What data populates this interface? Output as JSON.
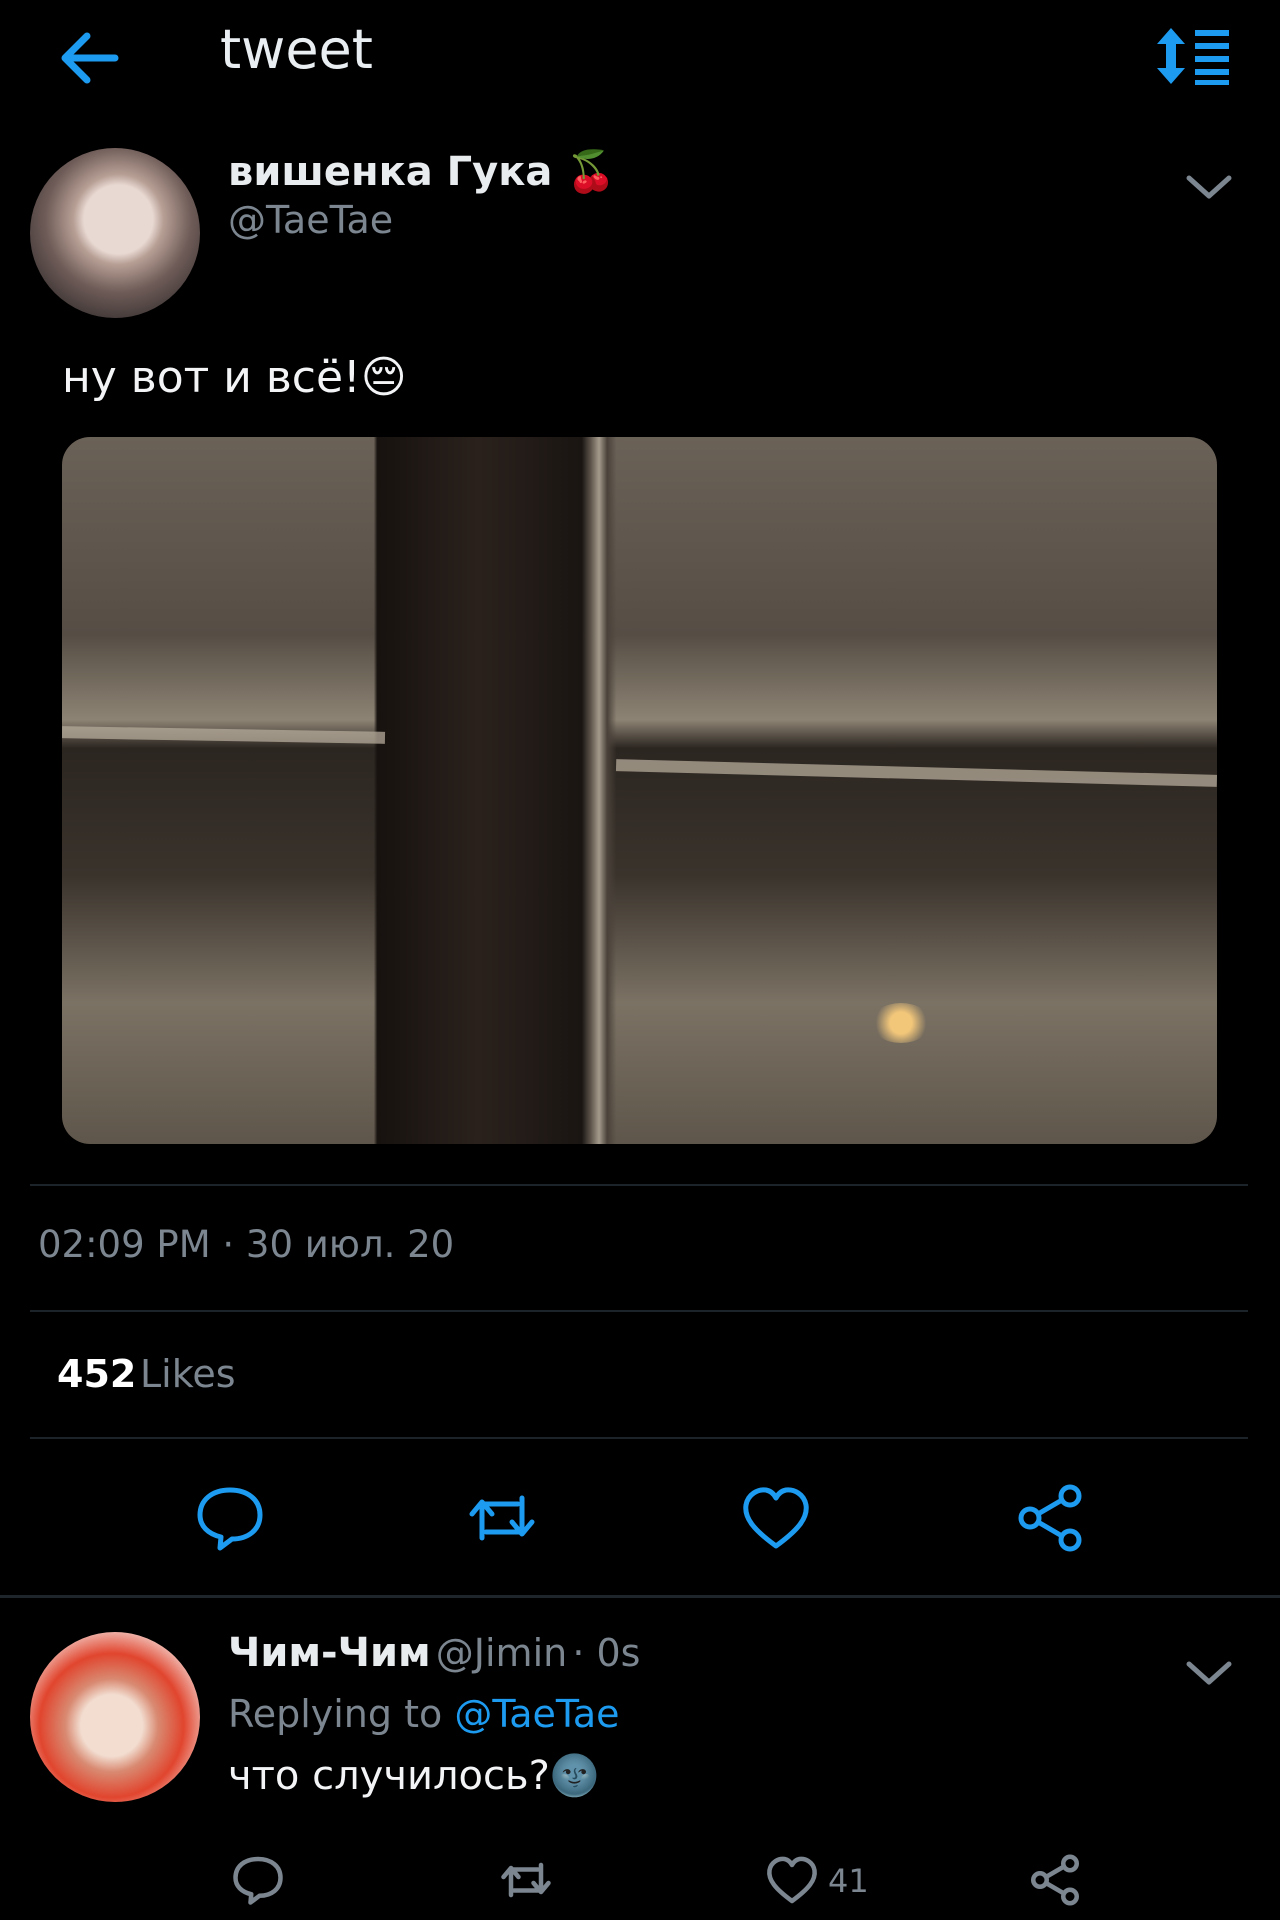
{
  "header": {
    "title": "tweet",
    "accent": "#1d9bf0"
  },
  "tweet": {
    "author_name": "вишенка Гука",
    "author_emoji": "🍒",
    "handle": "@TaeTae",
    "text": "ну вот и всё!",
    "text_emoji": "😔",
    "timestamp": "02:09 PM · 30 июл. 20",
    "likes_count": "452",
    "likes_label": "Likes",
    "actions": [
      "comment-icon",
      "retweet-icon",
      "heart-icon",
      "share-icon"
    ]
  },
  "reply": {
    "author_name": "Чим-Чим",
    "handle": "@Jimin",
    "age": "· 0s",
    "replying_prefix": "Replying to",
    "replying_handle": "@TaeTae",
    "text": "что случилось?",
    "text_emoji": "🌚",
    "like_count": "41"
  }
}
